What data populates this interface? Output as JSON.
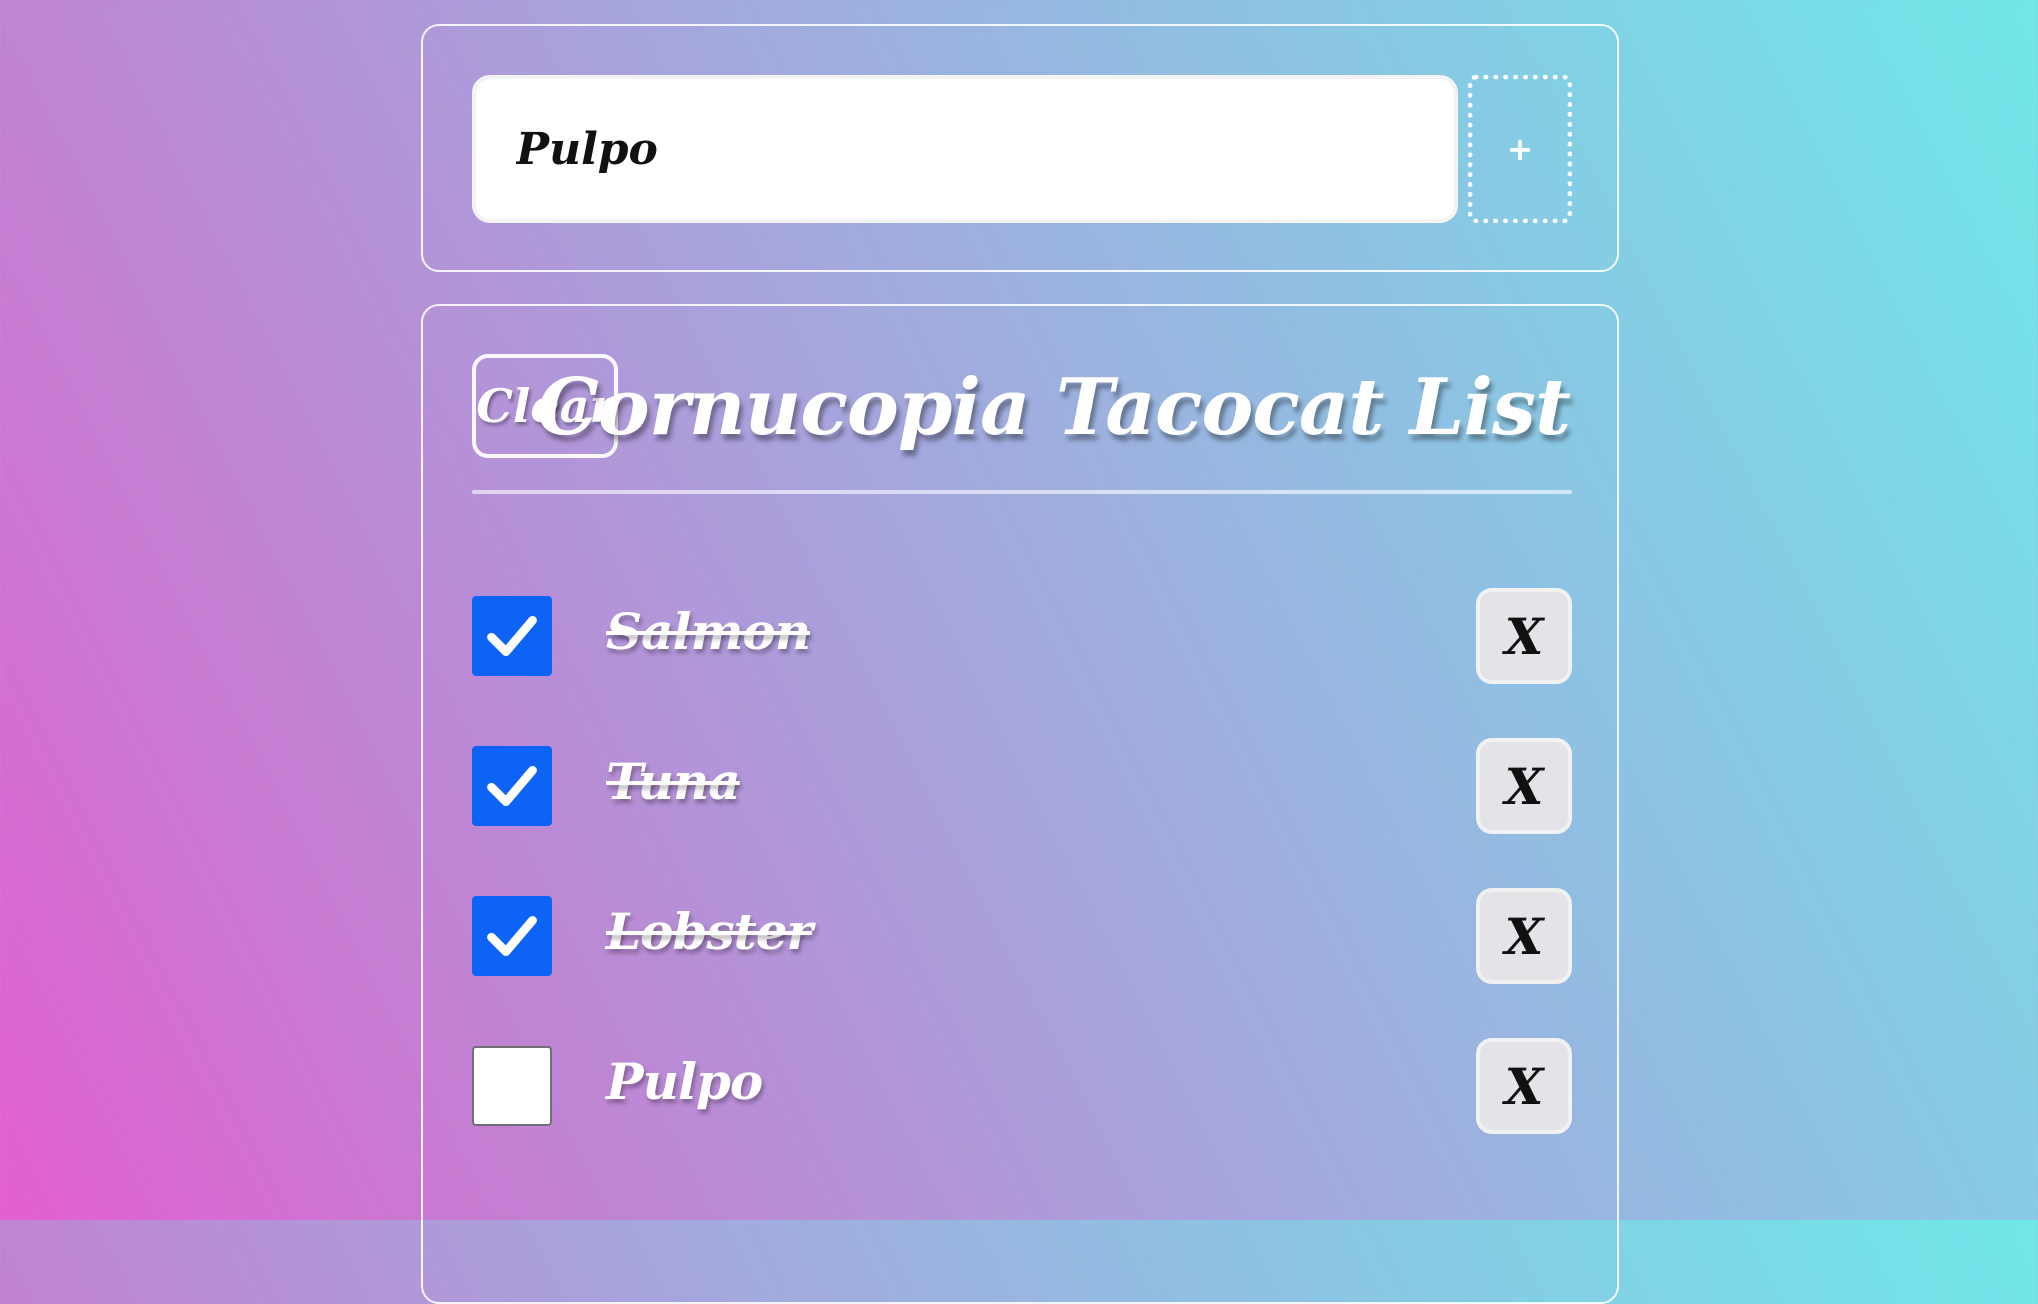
{
  "add_form": {
    "input_value": "Pulpo",
    "add_label": "+"
  },
  "list": {
    "clear_label": "Clear",
    "title": "Cornucopia Tacocat List",
    "items": [
      {
        "label": "Salmon",
        "checked": true,
        "delete_label": "X"
      },
      {
        "label": "Tuna",
        "checked": true,
        "delete_label": "X"
      },
      {
        "label": "Lobster",
        "checked": true,
        "delete_label": "X"
      },
      {
        "label": "Pulpo",
        "checked": false,
        "delete_label": "X"
      }
    ]
  },
  "colors": {
    "checkbox_checked": "#0d63f5",
    "delete_button_bg": "#e3e3e8",
    "gradient_start": "#e35fd0",
    "gradient_end": "#6fe7e8"
  },
  "icons": {
    "checkbox_checked": "checkmark-icon"
  }
}
